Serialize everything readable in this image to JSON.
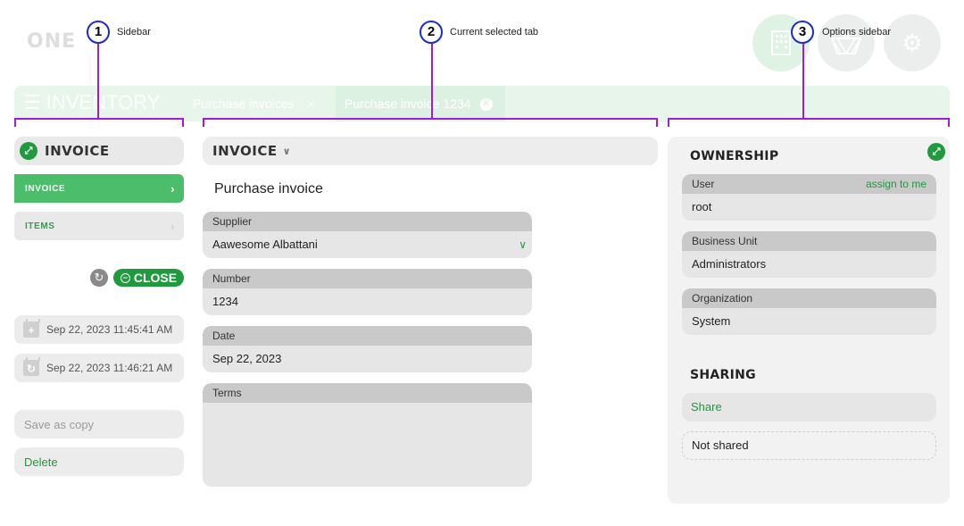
{
  "header": {
    "logo": "ONE",
    "menu_title": "INVENTORY",
    "tabs": [
      {
        "label": "Purchase invoices"
      },
      {
        "label": "Purchase invoice 1234"
      }
    ],
    "icons": [
      "building-icon",
      "basket-icon",
      "gears-icon"
    ]
  },
  "annotations": [
    {
      "number": "1",
      "label": "Sidebar"
    },
    {
      "number": "2",
      "label": "Current selected tab"
    },
    {
      "number": "3",
      "label": "Options sidebar"
    }
  ],
  "sidebar": {
    "title": "INVOICE",
    "items": [
      {
        "label": "INVOICE",
        "active": true
      },
      {
        "label": "ITEMS",
        "active": false
      }
    ],
    "close_label": "CLOSE",
    "created": "Sep 22, 2023 11:45:41 AM",
    "updated": "Sep 22, 2023 11:46:21 AM",
    "save_copy_label": "Save as copy",
    "delete_label": "Delete"
  },
  "main": {
    "section_title": "INVOICE",
    "form_title": "Purchase invoice",
    "fields": {
      "supplier": {
        "label": "Supplier",
        "value": "Aawesome Albattani"
      },
      "number": {
        "label": "Number",
        "value": "1234"
      },
      "date": {
        "label": "Date",
        "value": "Sep 22, 2023"
      },
      "terms": {
        "label": "Terms",
        "value": ""
      }
    }
  },
  "options": {
    "ownership_title": "OWNERSHIP",
    "user": {
      "label": "User",
      "value": "root",
      "assign_label": "assign to me"
    },
    "business_unit": {
      "label": "Business Unit",
      "value": "Administrators"
    },
    "organization": {
      "label": "Organization",
      "value": "System"
    },
    "sharing_title": "SHARING",
    "share_label": "Share",
    "not_shared_label": "Not shared"
  },
  "colors": {
    "accent_green": "#1f9a3d",
    "active_item": "#4bbd6b",
    "annotation_line": "#a21cd2",
    "annotation_circle": "#1a2ad6"
  }
}
